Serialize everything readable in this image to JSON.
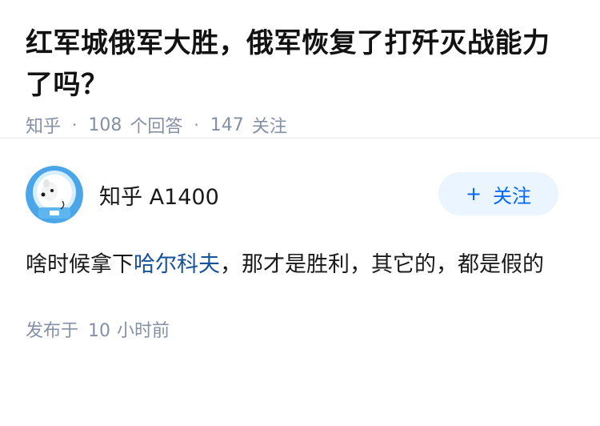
{
  "question": {
    "title": "红军城俄军大胜，俄军恢复了打歼灭战能力了吗？",
    "source": "知乎",
    "answer_count": "108",
    "answer_label": "个回答",
    "follower_count": "147",
    "follower_label": "关注"
  },
  "answer": {
    "author_name": "知乎 A1400",
    "follow_button_label": "关注",
    "follow_button_icon": "plus-icon",
    "content_before": "啥时候拿下",
    "content_link": "哈尔科夫",
    "content_after": "，那才是胜利，其它的，都是假的",
    "posted_label": "发布于",
    "posted_value": "10",
    "posted_unit": "小时前"
  },
  "colors": {
    "meta_gray": "#8590a6",
    "link_blue": "#175199",
    "brand_blue": "#0066ff",
    "follow_bg": "#ebf5ff"
  }
}
